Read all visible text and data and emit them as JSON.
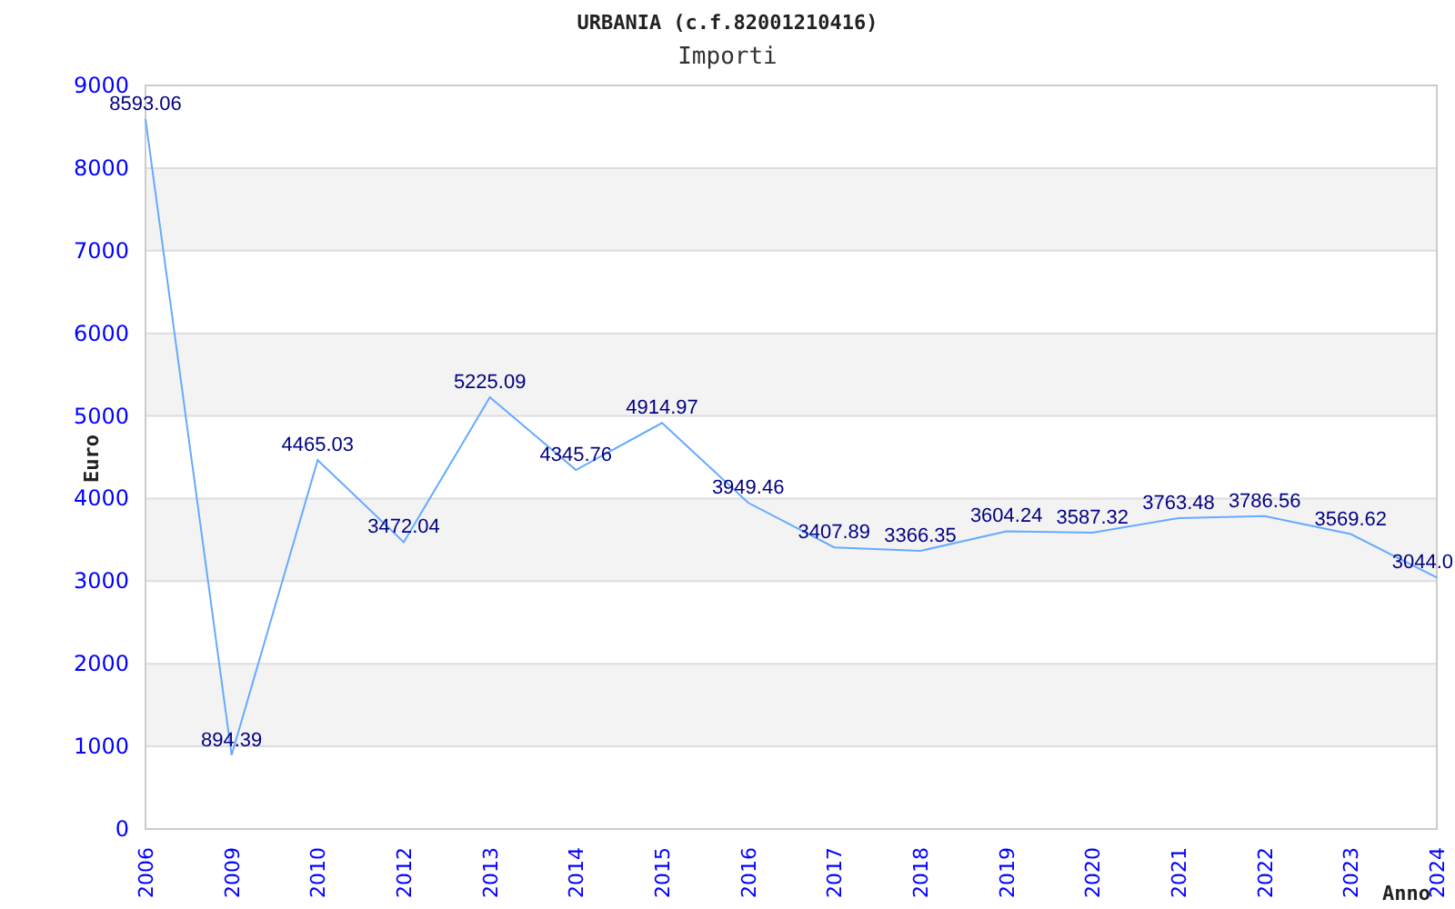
{
  "title": "URBANIA (c.f.82001210416)",
  "subtitle": "Importi",
  "chart_data": {
    "type": "line",
    "xlabel": "Anno",
    "ylabel": "Euro",
    "categories": [
      "2006",
      "2009",
      "2010",
      "2012",
      "2013",
      "2014",
      "2015",
      "2016",
      "2017",
      "2018",
      "2019",
      "2020",
      "2021",
      "2022",
      "2023",
      "2024"
    ],
    "grid": true,
    "series": [
      {
        "color": "#66aaff",
        "values": [
          8593.06,
          894.39,
          4465.03,
          3472.04,
          5225.09,
          4345.76,
          4914.97,
          3949.46,
          3407.89,
          3366.35,
          3604.24,
          3587.32,
          3763.48,
          3786.56,
          3569.62,
          3044.0
        ]
      }
    ],
    "value_labels": [
      "8593.06",
      "894.39",
      "4465.03",
      "3472.04",
      "5225.09",
      "4345.76",
      "4914.97",
      "3949.46",
      "3407.89",
      "3366.35",
      "3604.24",
      "3587.32",
      "3763.48",
      "3786.56",
      "3569.62",
      "3044.0"
    ],
    "ylim": [
      0,
      9000
    ],
    "yticks": [
      0,
      1000,
      2000,
      3000,
      4000,
      5000,
      6000,
      7000,
      8000,
      9000
    ]
  }
}
